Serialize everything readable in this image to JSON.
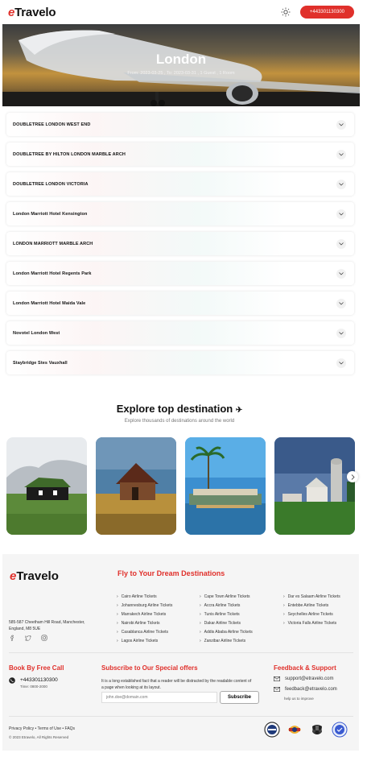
{
  "header": {
    "logo_prefix": "e",
    "logo_rest": "Travelo",
    "phone": "+443301130300"
  },
  "hero": {
    "title": "London",
    "subtitle": "From: 2023-03-25 , To: 2023-03-31 , 1 Guest , 1 Room"
  },
  "hotels": [
    "DOUBLETREE LONDON WEST END",
    "DOUBLETREE BY HILTON LONDON MARBLE ARCH",
    "DOUBLETREE LONDON VICTORIA",
    "London Marriott Hotel Kensington",
    "LONDON MARRIOTT MARBLE ARCH",
    "London Marriott Hotel Regents Park",
    "London Marriott Hotel Maida Vale",
    "Novotel London West",
    "Staybridge Stes Vauxhall"
  ],
  "explore": {
    "title": "Explore top destination",
    "subtitle": "Explore thousands of destinations around the world"
  },
  "footer": {
    "logo_prefix": "e",
    "logo_rest": "Travelo",
    "address": "585-587 Cheetham Hill Road, Manchester, England, M8 5UE",
    "dream_title": "Fly to Your Dream Destinations",
    "col1": [
      "Cairo Airline Tickets",
      "Johannesburg Airline Tickets",
      "Marrakech Airline Tickets",
      "Nairobi Airline Tickets",
      "Casablanca Airline Tickets",
      "Lagos Airline Tickets"
    ],
    "col2": [
      "Cape Town Airline Tickets",
      "Accra Airline Tickets",
      "Tunis Airline Tickets",
      "Dakar Airline Tickets",
      "Addis Ababa Airline Tickets",
      "Zanzibar Airline Tickets"
    ],
    "col3": [
      "Dar es Salaam Airline Tickets",
      "Entebbe Airline Tickets",
      "Seychelles Airline Tickets",
      "Victoria Falls Airline Tickets"
    ],
    "book_title": "Book By Free Call",
    "book_phone": "+443301130300",
    "book_time": "Time: 0800-2000",
    "subscribe_title": "Subscribe to Our Special offers",
    "subscribe_text": "It is a long established fact that a reader will be distracted by the readable content of a page when looking at its layout.",
    "subscribe_placeholder": "john.doe@domain.com",
    "subscribe_button": "Subscribe",
    "feedback_title": "Feedback & Support",
    "support_email": "support@etravelo.com",
    "feedback_email": "feedback@etravelo.com",
    "feedback_help": "help us to improve",
    "bottom_links": "Privacy Policy  •  Terms of Use  •  FAQs",
    "copyright": "© 2023 Etravelo, All Rights Reserved"
  },
  "colors": {
    "accent": "#e0302b"
  }
}
